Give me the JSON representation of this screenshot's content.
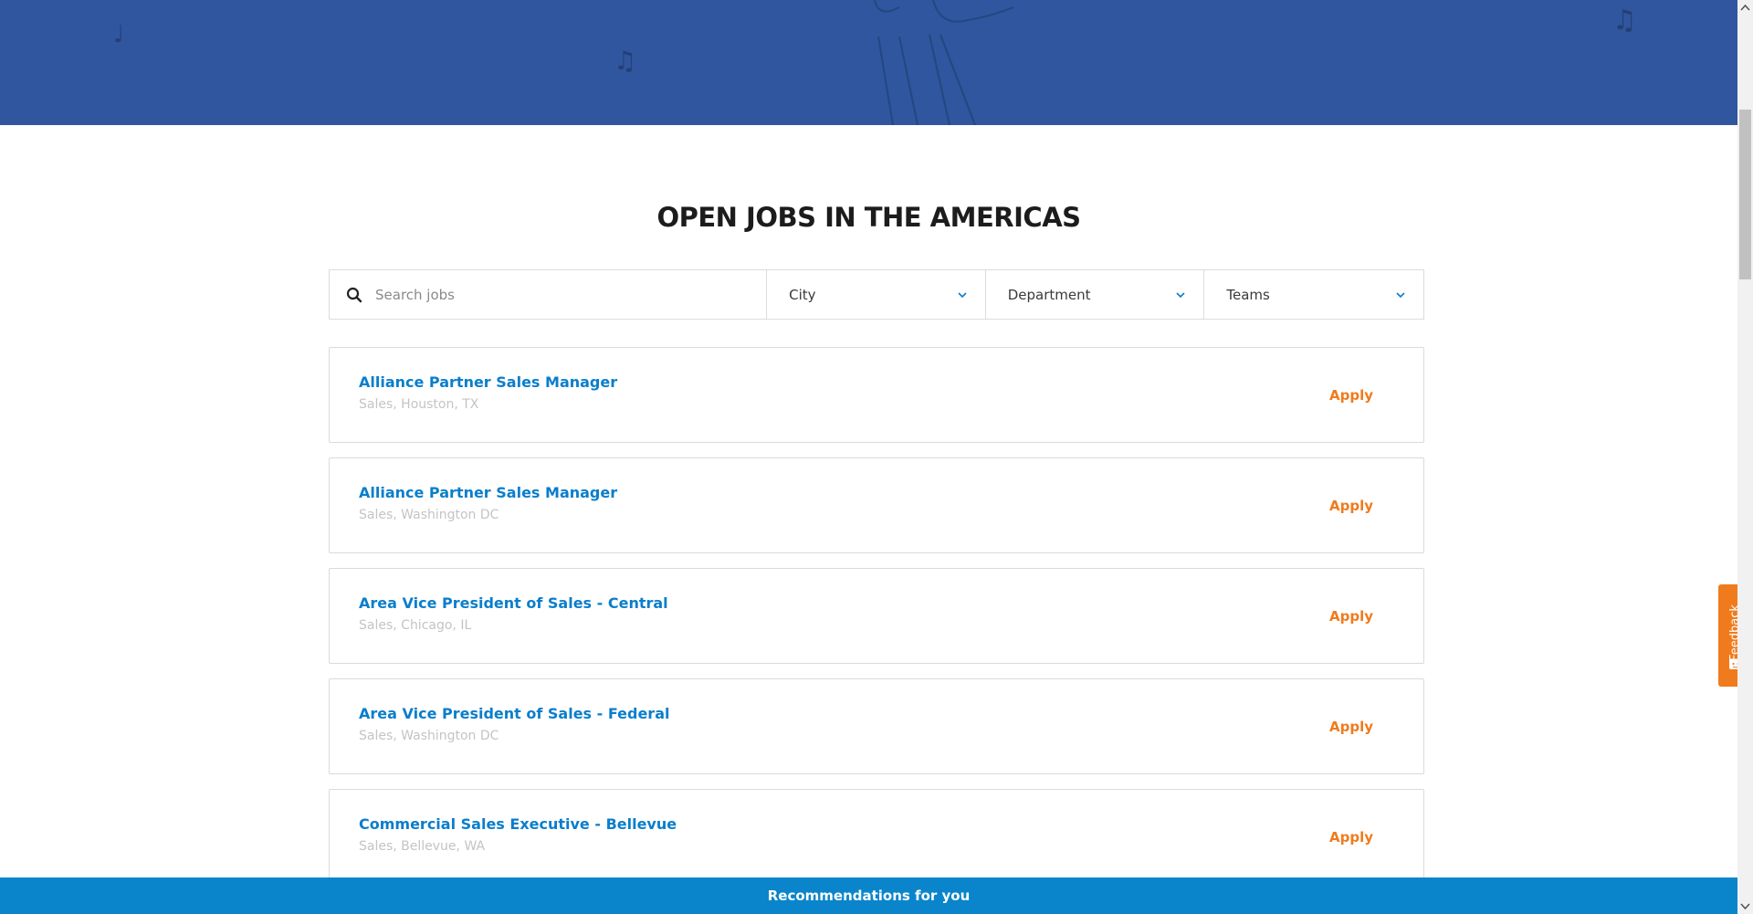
{
  "colors": {
    "hero_bg": "#2f569e",
    "job_title": "#0a7ecb",
    "apply": "#f07b1d",
    "meta": "#c4c4c4",
    "reco_bar": "#0a85cb",
    "feedback": "#f07b1d"
  },
  "section": {
    "title": "OPEN JOBS IN THE AMERICAS"
  },
  "filters": {
    "search_placeholder": "Search jobs",
    "search_icon": "search-icon",
    "city_label": "City",
    "department_label": "Department",
    "teams_label": "Teams"
  },
  "jobs": [
    {
      "title": "Alliance Partner Sales Manager",
      "meta": "Sales, Houston, TX",
      "apply": "Apply"
    },
    {
      "title": "Alliance Partner Sales Manager",
      "meta": "Sales, Washington DC",
      "apply": "Apply"
    },
    {
      "title": "Area Vice President of Sales - Central",
      "meta": "Sales, Chicago, IL",
      "apply": "Apply"
    },
    {
      "title": "Area Vice President of Sales - Federal",
      "meta": "Sales, Washington DC",
      "apply": "Apply"
    },
    {
      "title": "Commercial Sales Executive - Bellevue",
      "meta": "Sales, Bellevue, WA",
      "apply": "Apply"
    }
  ],
  "recommendations": {
    "label": "Recommendations for you"
  },
  "feedback": {
    "label": "Feedback",
    "icon": "feedback-icon"
  }
}
